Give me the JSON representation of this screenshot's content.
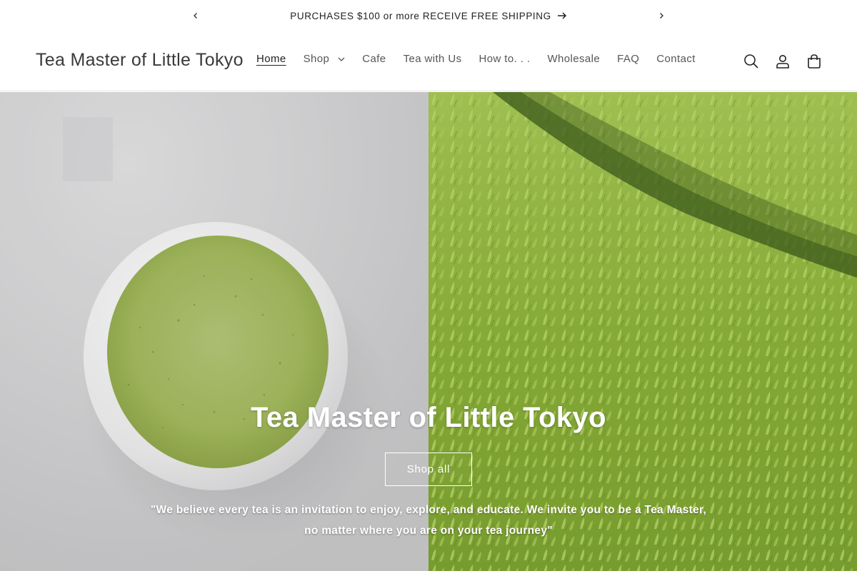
{
  "announcement": {
    "text": "PURCHASES $100 or more RECEIVE FREE SHIPPING"
  },
  "header": {
    "logo": "Tea Master of Little Tokyo",
    "nav": [
      {
        "label": "Home",
        "active": true
      },
      {
        "label": "Shop",
        "has_dropdown": true
      },
      {
        "label": "Cafe"
      },
      {
        "label": "Tea with Us"
      },
      {
        "label": "How to. . ."
      },
      {
        "label": "Wholesale"
      },
      {
        "label": "FAQ"
      },
      {
        "label": "Contact"
      }
    ],
    "icons": [
      "search-icon",
      "account-icon",
      "cart-icon"
    ]
  },
  "hero": {
    "title": "Tea Master of Little Tokyo",
    "button_label": "Shop all",
    "quote": "\"We believe every tea is an invitation to enjoy, explore, and educate. We invite you to be a Tea Master, no matter where you are on your tea journey\""
  },
  "colors": {
    "text": "#222222",
    "nav_text": "#555555",
    "matcha": "#a6bd5f",
    "tea_field": "#8db63a"
  }
}
